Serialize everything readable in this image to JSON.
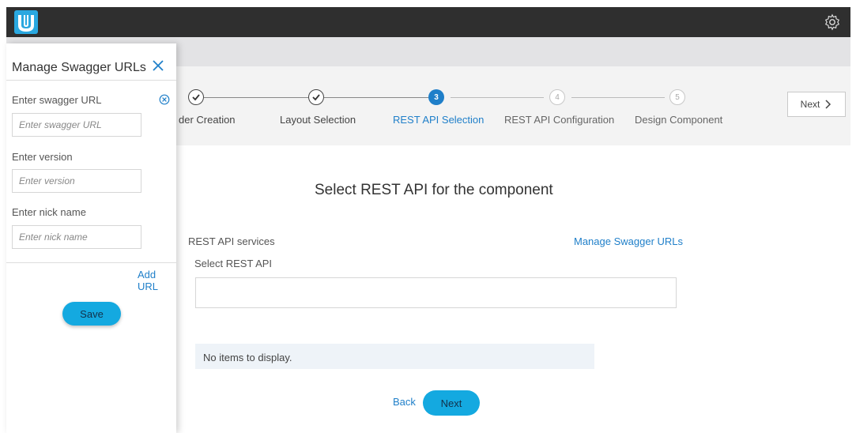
{
  "header": {
    "logo_icon": "brand-logo-icon",
    "settings_icon": "gear-icon"
  },
  "stepper": {
    "steps": [
      {
        "label": "der Creation",
        "state": "done"
      },
      {
        "label": "Layout Selection",
        "state": "done"
      },
      {
        "label": "REST API Selection",
        "number": "3",
        "state": "active"
      },
      {
        "label": "REST API Configuration",
        "number": "4",
        "state": "todo"
      },
      {
        "label": "Design Component",
        "number": "5",
        "state": "todo"
      }
    ],
    "next_label": "Next"
  },
  "main": {
    "title": "Select REST API for the component",
    "services_label": "REST API services",
    "manage_link": "Manage Swagger URLs",
    "select_label": "Select REST API",
    "select_value": "",
    "empty_message": "No items to display.",
    "back_label": "Back",
    "next_label": "Next"
  },
  "panel": {
    "title": "Manage Swagger URLs",
    "fields": [
      {
        "label": "Enter swagger URL",
        "placeholder": "Enter swagger URL",
        "value": ""
      },
      {
        "label": "Enter version",
        "placeholder": "Enter version",
        "value": ""
      },
      {
        "label": "Enter nick name",
        "placeholder": "Enter nick name",
        "value": ""
      }
    ],
    "add_url_label": "Add URL",
    "save_label": "Save"
  },
  "colors": {
    "accent": "#1f7fc9",
    "button": "#14a9e0",
    "topbar": "#2f2f2f"
  }
}
